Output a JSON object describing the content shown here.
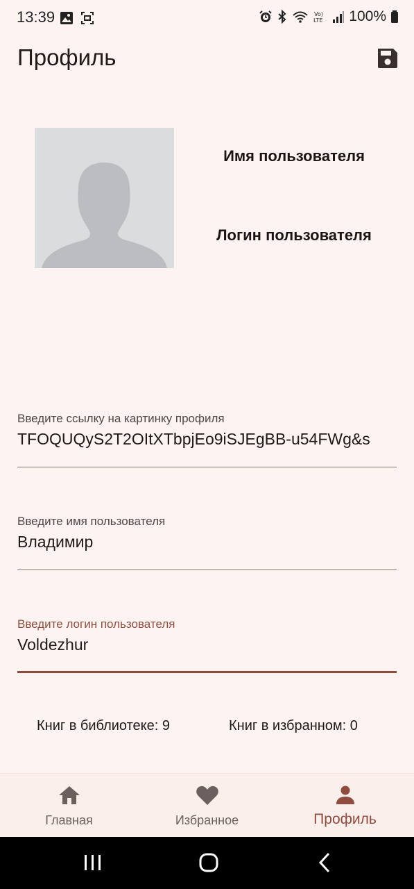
{
  "status_bar": {
    "time": "13:39",
    "battery": "100%",
    "icons": [
      "gallery-icon",
      "screenshot-icon",
      "alarm-icon",
      "bluetooth-icon",
      "wifi-icon",
      "volte-icon",
      "signal-icon",
      "battery-icon"
    ]
  },
  "app_bar": {
    "title": "Профиль",
    "save_icon": "save-icon"
  },
  "profile": {
    "avatar_icon": "avatar-placeholder-icon",
    "name": "Имя пользователя",
    "login": "Логин пользователя"
  },
  "fields": {
    "image_url": {
      "label": "Введите ссылку на картинку профиля",
      "value": "TFOQUQyS2T2OItXTbpjEo9iSJEgBB-u54FWg&s"
    },
    "username": {
      "label": "Введите имя пользователя",
      "value": "Владимир"
    },
    "login": {
      "label": "Введите логин пользователя",
      "value": "Voldezhur"
    }
  },
  "stats": {
    "library": "Книг в библиотеке: 9",
    "favorites": "Книг в избранном: 0"
  },
  "bottom_nav": {
    "items": [
      {
        "label": "Главная",
        "icon": "home-icon"
      },
      {
        "label": "Избранное",
        "icon": "heart-icon"
      },
      {
        "label": "Профиль",
        "icon": "person-icon"
      }
    ],
    "active_index": 2
  },
  "colors": {
    "background": "#fdf4f2",
    "accent": "#8f4c3e",
    "nav_background": "#fbefec"
  }
}
